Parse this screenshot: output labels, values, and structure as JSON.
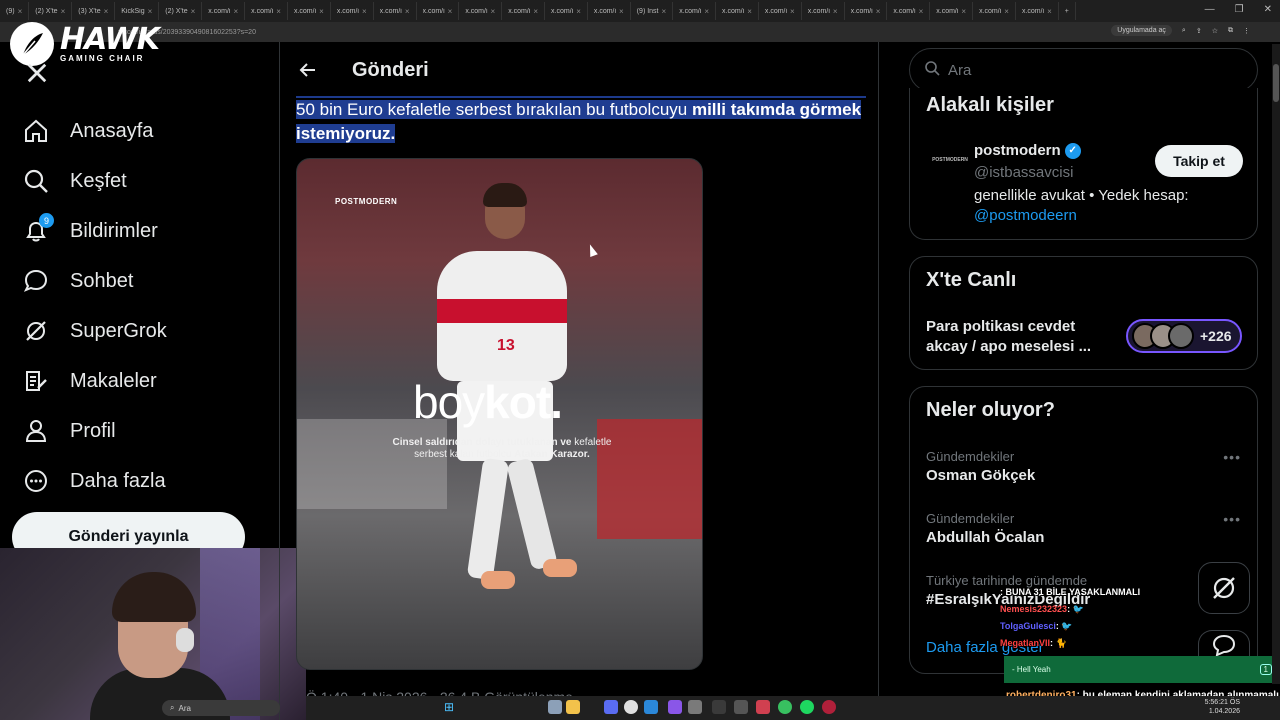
{
  "browser": {
    "tabs": [
      "(9)",
      "(2) X'te",
      "(3) X'te",
      "KickSig",
      "(2) X'te",
      "x.com/i",
      "x.com/i",
      "x.com/i",
      "x.com/i",
      "x.com/i",
      "x.com/i",
      "x.com/i",
      "x.com/i",
      "x.com/i",
      "x.com/i",
      "(9) Inst",
      "x.com/i",
      "x.com/i",
      "x.com/i",
      "x.com/i",
      "x.com/i",
      "x.com/i",
      "x.com/i",
      "x.com/i",
      "x.com/i"
    ],
    "url": "x.com/i/status/2039339049081602253?s=20",
    "app_mode_label": "Uygulamada aç"
  },
  "overlay_logo": {
    "title": "HAWK",
    "subtitle": "GAMING CHAIR"
  },
  "nav": {
    "items": [
      {
        "label": "Anasayfa",
        "icon": "home-icon"
      },
      {
        "label": "Keşfet",
        "icon": "search-icon"
      },
      {
        "label": "Bildirimler",
        "icon": "bell-icon"
      },
      {
        "label": "Sohbet",
        "icon": "chat-icon"
      },
      {
        "label": "SuperGrok",
        "icon": "grok-icon"
      },
      {
        "label": "Makaleler",
        "icon": "article-icon"
      },
      {
        "label": "Profil",
        "icon": "person-icon"
      },
      {
        "label": "Daha fazla",
        "icon": "more-circle-icon"
      }
    ],
    "notification_count": "9",
    "post_button": "Gönderi yayınla"
  },
  "main": {
    "title": "Gönderi",
    "tweet_normal": "50 bin Euro kefaletle serbest bırakılan bu futbolcuyu ",
    "tweet_bold": "milli takımda görmek istemiyoruz.",
    "image": {
      "brand": "POSTMODERN",
      "headline_light": "boy",
      "headline_bold": "kot.",
      "caption_bold_1": "Cinsel saldırıdan dolayı tutuklanan ve",
      "caption_light_1": " kefaletle serbest kalan futbolcu ",
      "caption_bold_2": "Atakan Karazor.",
      "jersey_number": "13"
    },
    "meta": "Ö 1:40 · 1 Nis 2026 · 26,4 B Görüntülenme"
  },
  "right": {
    "search_placeholder": "Ara",
    "relevant": {
      "title": "Alakalı kişiler",
      "avatar_text": "POSTMODERN",
      "name": "postmodern",
      "handle": "@istbassavcisi",
      "bio": "genellikle avukat • Yedek hesap: ",
      "bio_link": "@postmodeern",
      "follow": "Takip et"
    },
    "live": {
      "title": "X'te Canlı",
      "text": "Para poltikası cevdet akcay / apo meselesi ...",
      "count": "+226"
    },
    "trends": {
      "title": "Neler oluyor?",
      "items": [
        {
          "context": "Gündemdekiler",
          "name": "Osman Gökçek"
        },
        {
          "context": "Gündemdekiler",
          "name": "Abdullah Öcalan"
        },
        {
          "context": "Türkiye tarihinde gündemde",
          "name": "#EsraIşıkYalnızDeğildir"
        }
      ],
      "show_more": "Daha fazla göster"
    }
  },
  "chat": {
    "lines": [
      {
        "user": "",
        "text": ": BUNA 31 BİLE YASAKLANMALI"
      },
      {
        "user": "Nemesis232323",
        "text": ": 🐦"
      },
      {
        "user": "TolgaGulesci",
        "text": ": 🐦"
      },
      {
        "user": "MegatlanVII",
        "text": ": 🐈"
      }
    ],
    "hype": {
      "user": "",
      "text": "- Hell Yeah",
      "count": "1"
    },
    "robert_user": "robertdeniro31",
    "robert_text": ": bu eleman kendini aklamadan alınmamalı"
  },
  "taskbar": {
    "search": "Ara",
    "time": "5:56:21 ÖS",
    "date": "1.04.2026"
  },
  "colors": {
    "accent": "#1d9bf0",
    "highlight": "#1f3d91",
    "live_border": "#7856ff",
    "hype_green": "#0f6a3a"
  }
}
